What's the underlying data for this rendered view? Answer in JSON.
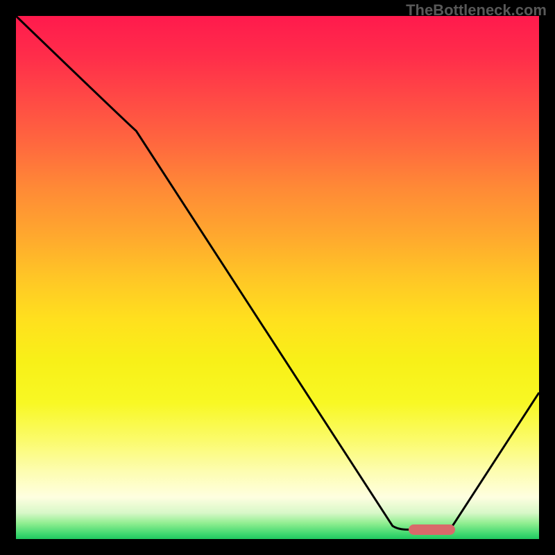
{
  "watermark": "TheBottleneck.com",
  "chart_data": {
    "type": "line",
    "title": "",
    "xlabel": "",
    "ylabel": "",
    "xlim": [
      0,
      100
    ],
    "ylim": [
      0,
      100
    ],
    "series": [
      {
        "name": "bottleneck-curve",
        "x": [
          0,
          23,
          72,
          75,
          82,
          100
        ],
        "values": [
          100,
          78,
          2.5,
          1.8,
          1.8,
          28
        ]
      }
    ],
    "annotations": [
      {
        "name": "optimal-marker",
        "x_start": 75,
        "x_end": 84,
        "y": 1.8
      }
    ],
    "background": "vertical-gradient red→yellow→green (bottleneck severity)"
  },
  "colors": {
    "curve": "#000000",
    "marker": "#d96a6a",
    "frame": "#000000"
  }
}
